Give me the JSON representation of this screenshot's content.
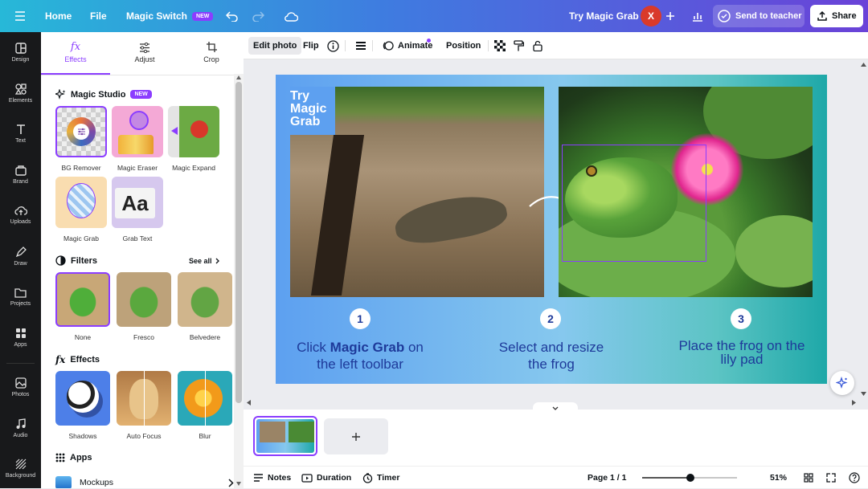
{
  "topbar": {
    "home": "Home",
    "file": "File",
    "magic_switch": "Magic Switch",
    "new_badge": "NEW",
    "try_magic_grab": "Try Magic Grab",
    "avatar_letter": "X",
    "send_to_teacher": "Send to teacher",
    "share": "Share"
  },
  "rail": {
    "items": [
      "Design",
      "Elements",
      "Text",
      "Brand",
      "Uploads",
      "Draw",
      "Projects",
      "Apps",
      "Photos",
      "Audio",
      "Background"
    ]
  },
  "panel": {
    "tabs": [
      "Effects",
      "Adjust",
      "Crop"
    ],
    "magic_studio_title": "Magic Studio",
    "magic_studio_badge": "NEW",
    "magic_items": [
      "BG Remover",
      "Magic Eraser",
      "Magic Expand",
      "Magic Grab",
      "Grab Text"
    ],
    "filters_title": "Filters",
    "see_all": "See all",
    "filters": [
      "None",
      "Fresco",
      "Belvedere"
    ],
    "effects_title": "Effects",
    "effects": [
      "Shadows",
      "Auto Focus",
      "Blur"
    ],
    "apps_title": "Apps",
    "apps_item": "Mockups"
  },
  "toolbar": {
    "edit_photo": "Edit photo",
    "flip": "Flip",
    "animate": "Animate",
    "position": "Position"
  },
  "slide": {
    "badge": "Try\nMagic\nGrab",
    "step1_num": "1",
    "step2_num": "2",
    "step3_num": "3",
    "step1_pre": "Click ",
    "step1_bold": "Magic Grab",
    "step1_post": " on",
    "step1_line2": "the left toolbar",
    "step2_line1": "Select and resize",
    "step2_line2": "the frog",
    "step3_line1": "Place the frog on the",
    "step3_line2": "lily pad"
  },
  "bottombar": {
    "notes": "Notes",
    "duration": "Duration",
    "timer": "Timer",
    "page": "Page 1 / 1",
    "zoom_label": "51%",
    "zoom_value": 51
  },
  "colors": {
    "accent": "#8b3dff",
    "avatar": "#d93a2a",
    "text_blue": "#1e3a9a"
  }
}
